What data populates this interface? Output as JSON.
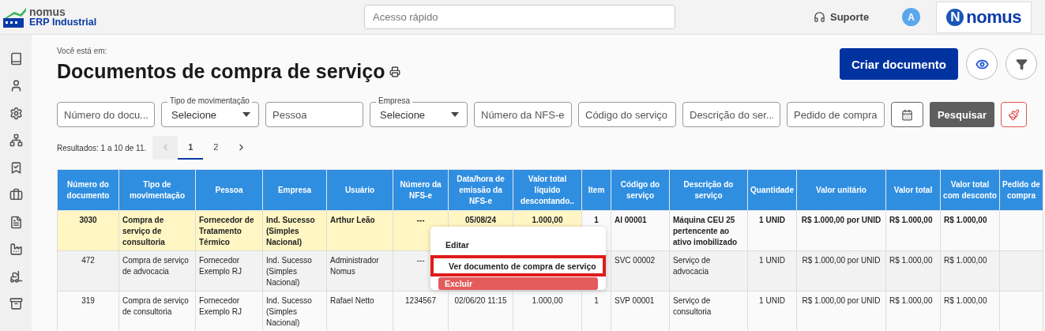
{
  "app_logo": {
    "name": "nomus",
    "subtitle": "ERP Industrial"
  },
  "quick_access": {
    "placeholder": "Acesso rápido"
  },
  "support": {
    "label": "Suporte"
  },
  "avatar": {
    "initial": "A"
  },
  "brand_logo": {
    "mark": "N",
    "text": "nomus"
  },
  "breadcrumb": "Você está em:",
  "title": "Documentos de compra de serviço",
  "create_button": "Criar documento",
  "filters": [
    {
      "kind": "text",
      "placeholder": "Número do docu..."
    },
    {
      "kind": "select",
      "label": "Tipo de movimentação",
      "value": "Selecione"
    },
    {
      "kind": "text",
      "placeholder": "Pessoa"
    },
    {
      "kind": "select",
      "label": "Empresa",
      "value": "Selecione"
    },
    {
      "kind": "text",
      "placeholder": "Número da NFS-e"
    },
    {
      "kind": "text",
      "placeholder": "Código do serviço"
    },
    {
      "kind": "text",
      "placeholder": "Descrição do ser..."
    },
    {
      "kind": "text",
      "placeholder": "Pedido de compra"
    }
  ],
  "search_button": "Pesquisar",
  "results": "Resultados: 1 a 10 de 11.",
  "pagination": [
    {
      "kind": "prev",
      "disabled": true
    },
    {
      "kind": "page",
      "label": "1",
      "selected": true
    },
    {
      "kind": "page",
      "label": "2",
      "selected": false
    },
    {
      "kind": "next",
      "disabled": false
    }
  ],
  "table": {
    "columns": [
      "Número do documento",
      "Tipo de movimentação",
      "Pessoa",
      "Empresa",
      "Usuário",
      "Número da NFS-e",
      "Data/hora de emissão da NFS-e",
      "Valor total líquido descontando..",
      "Item",
      "Código do serviço",
      "Descrição do serviço",
      "Quantidade",
      "Valor unitário",
      "Valor total",
      "Valor total com desconto",
      "Pedido de compra"
    ],
    "rows": [
      {
        "selected": true,
        "cells": [
          "3030",
          "Compra de serviço de consultoria",
          "Fornecedor de Tratamento Térmico",
          "Ind. Sucesso (Simples Nacional)",
          "Arthur Leão",
          "---",
          "05/08/24",
          "1.000,00",
          "1",
          "AI 00001",
          "Máquina CEU 25 pertencente ao ativo imobilizado",
          "1 UNID",
          "R$ 1.000,00 por UNID",
          "R$ 1.000,00",
          "R$ 1.000,00",
          ""
        ]
      },
      {
        "selected": false,
        "cells": [
          "472",
          "Compra de serviço de advocacia",
          "Fornecedor Exemplo RJ",
          "Ind. Sucesso (Simples Nacional)",
          "Administrador Nomus",
          "---",
          "",
          "",
          "",
          "SVC 00002",
          "Serviço de advocacia",
          "1 UNID",
          "R$ 1.000,00 por UNID",
          "R$ 1.000,00",
          "R$ 1.000,00",
          ""
        ]
      },
      {
        "selected": false,
        "cells": [
          "319",
          "Compra de serviço de consultoria",
          "Fornecedor Exemplo RJ",
          "Ind. Sucesso (Simples Nacional)",
          "Rafael Netto",
          "1234567",
          "02/06/20 11:15",
          "1.000,00",
          "1",
          "SVP 00001",
          "Serviço de consultoria",
          "1 UNID",
          "R$ 1.000,00 por UNID",
          "R$ 1.000,00",
          "R$ 1.000,00",
          ""
        ]
      }
    ]
  },
  "context_menu": {
    "items": [
      {
        "kind": "normal",
        "label": "Editar",
        "highlighted": false
      },
      {
        "kind": "normal",
        "label": "Ver documento de compra de serviço",
        "highlighted": true
      },
      {
        "kind": "danger",
        "label": "Excluir",
        "highlighted": false
      }
    ]
  }
}
